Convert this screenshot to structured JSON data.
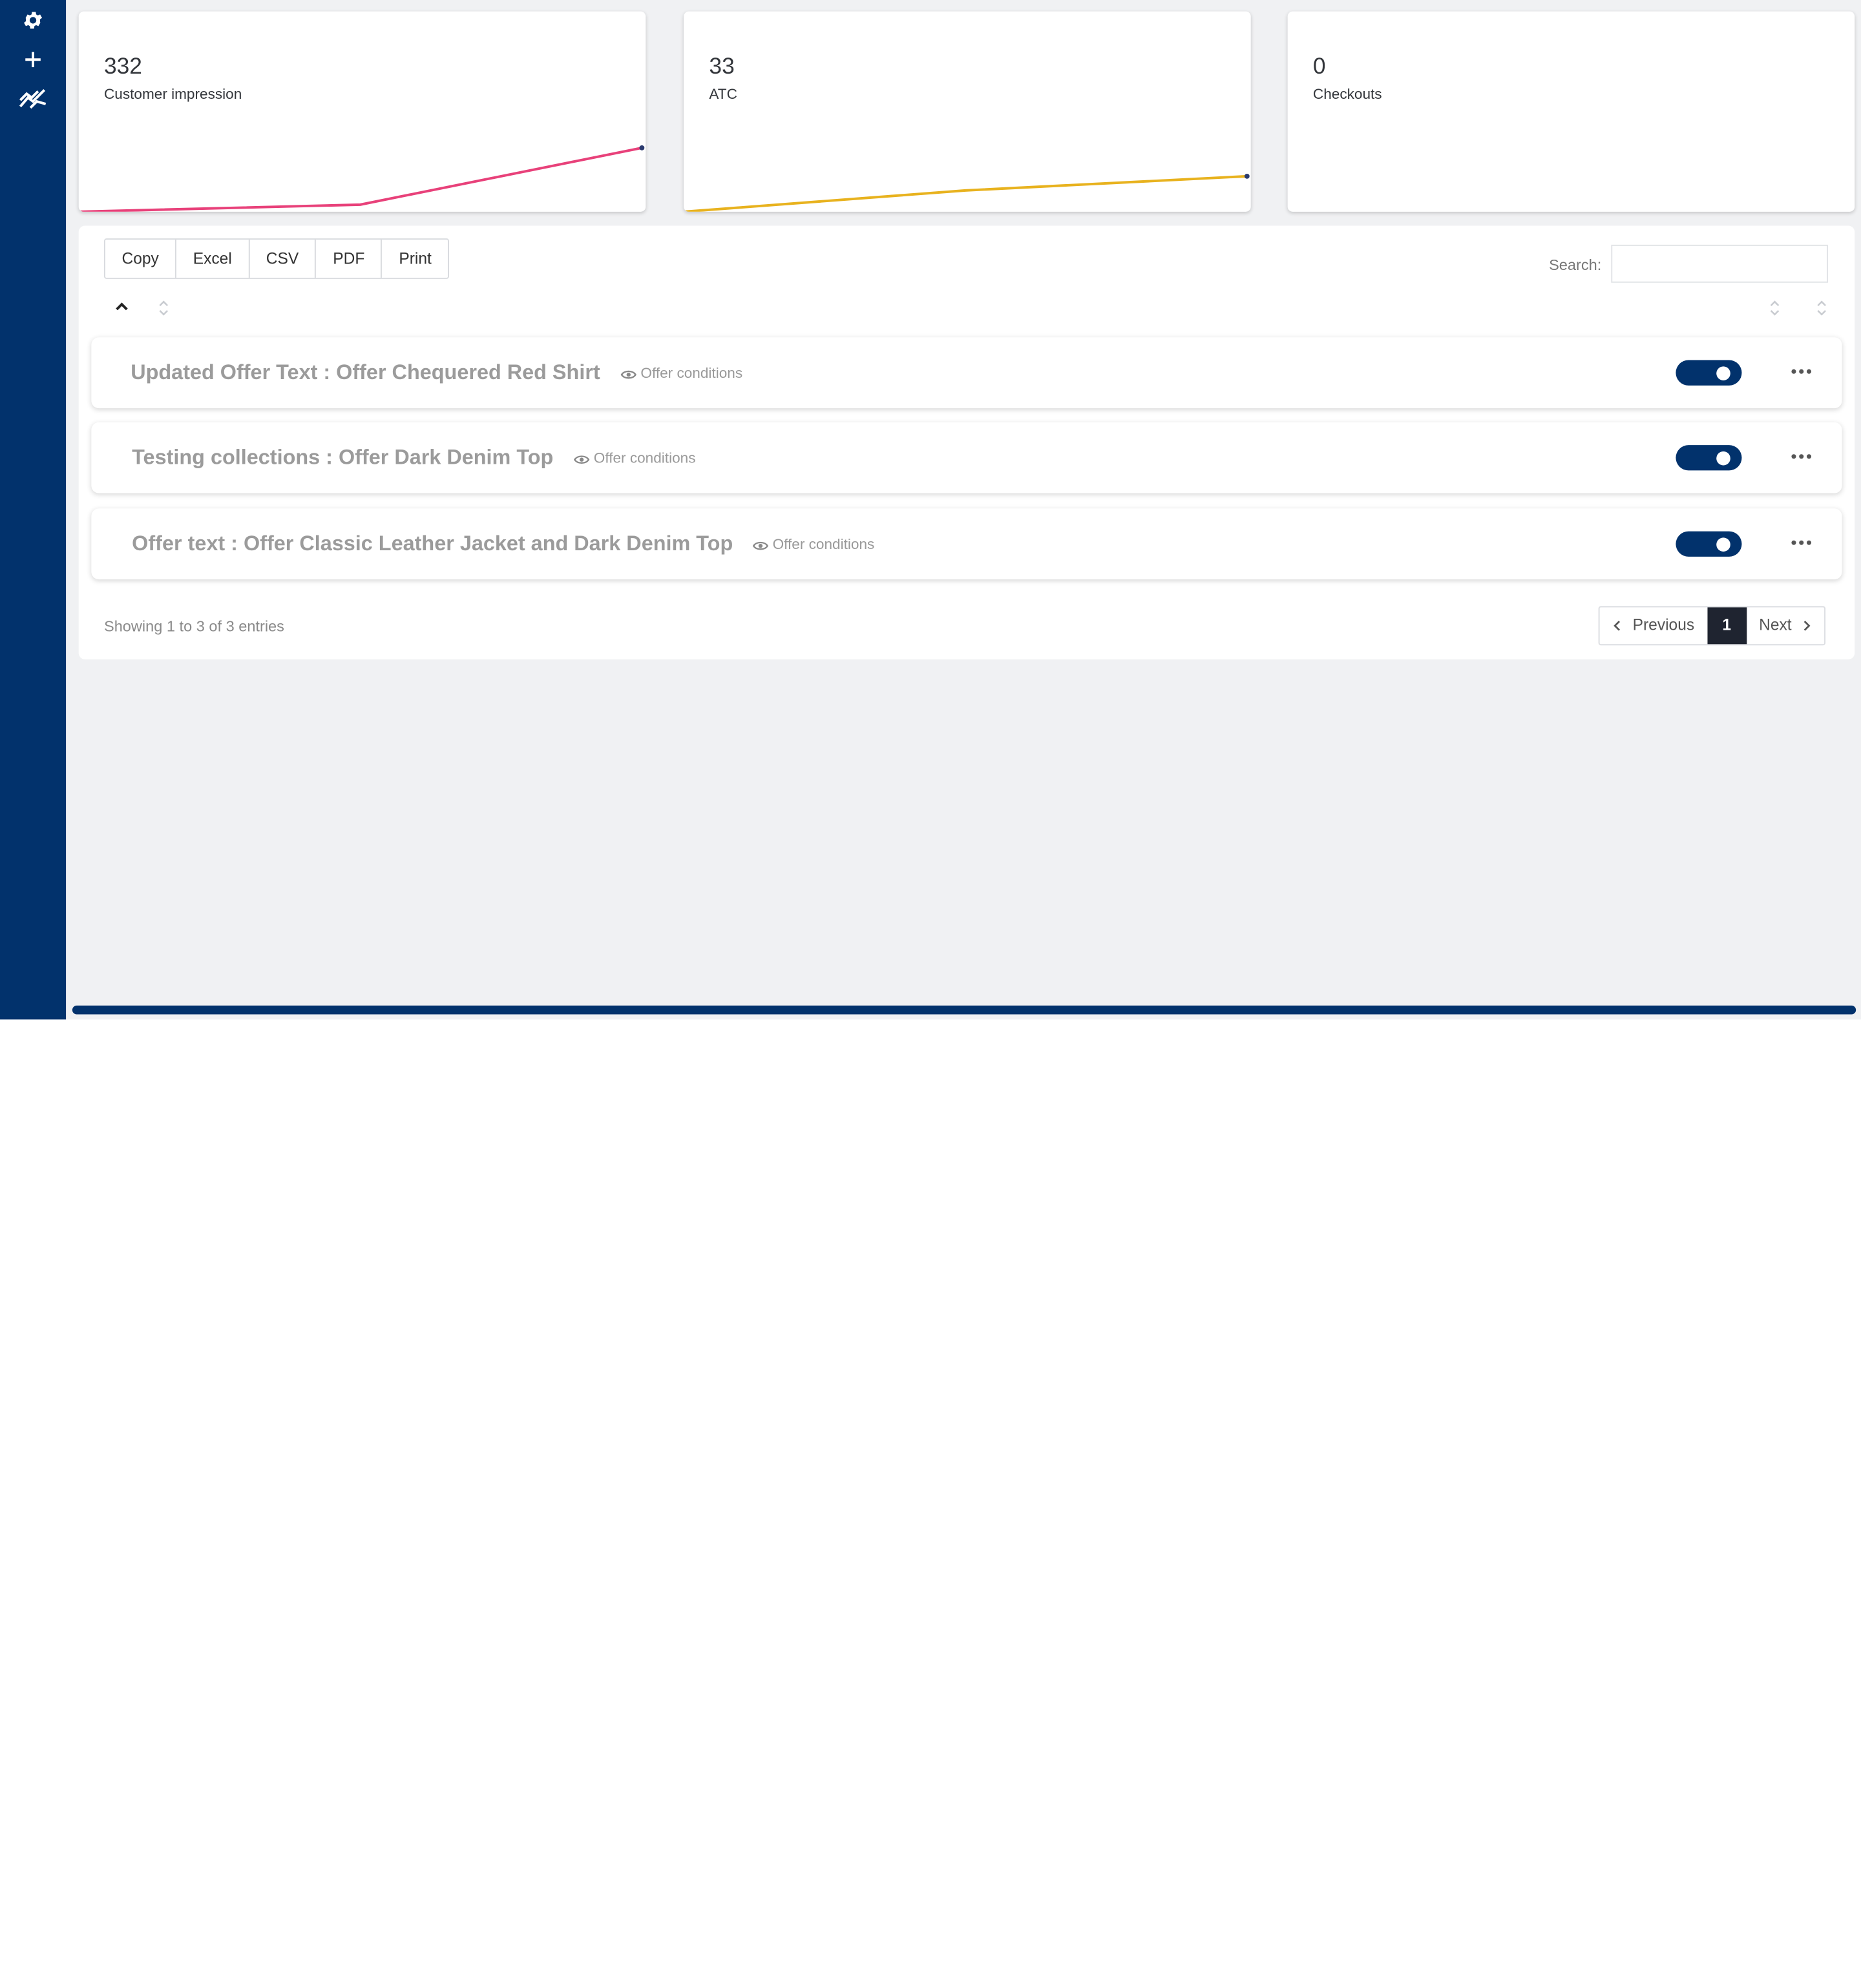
{
  "sidebar": {
    "icons": [
      "gear-icon",
      "plus-icon",
      "analytics-chart-icon"
    ],
    "color": "#02326c"
  },
  "stats": [
    {
      "value": "332",
      "label": "Customer impression",
      "line_color": "#e8417a",
      "trend": [
        0,
        4,
        36
      ]
    },
    {
      "value": "33",
      "label": "ATC",
      "line_color": "#e8b21e",
      "trend": [
        0,
        12,
        20
      ]
    },
    {
      "value": "0",
      "label": "Checkouts",
      "line_color": "#3a7bd5",
      "trend": []
    }
  ],
  "toolbar": {
    "buttons": [
      "Copy",
      "Excel",
      "CSV",
      "PDF",
      "Print"
    ],
    "search_label": "Search:",
    "search_value": ""
  },
  "offers": [
    {
      "title": "Updated Offer Text : Offer Chequered Red Shirt",
      "conditions_label": "Offer conditions",
      "enabled": true
    },
    {
      "title": "Testing collections : Offer Dark Denim Top",
      "conditions_label": "Offer conditions",
      "enabled": true
    },
    {
      "title": "Offer text : Offer Classic Leather Jacket and Dark Denim Top",
      "conditions_label": "Offer conditions",
      "enabled": true
    }
  ],
  "footer": {
    "info": "Showing 1 to 3 of 3 entries",
    "pagination": {
      "previous": "Previous",
      "current": "1",
      "next": "Next"
    }
  },
  "colors": {
    "accent": "#02326c",
    "background": "#f0f1f3"
  }
}
